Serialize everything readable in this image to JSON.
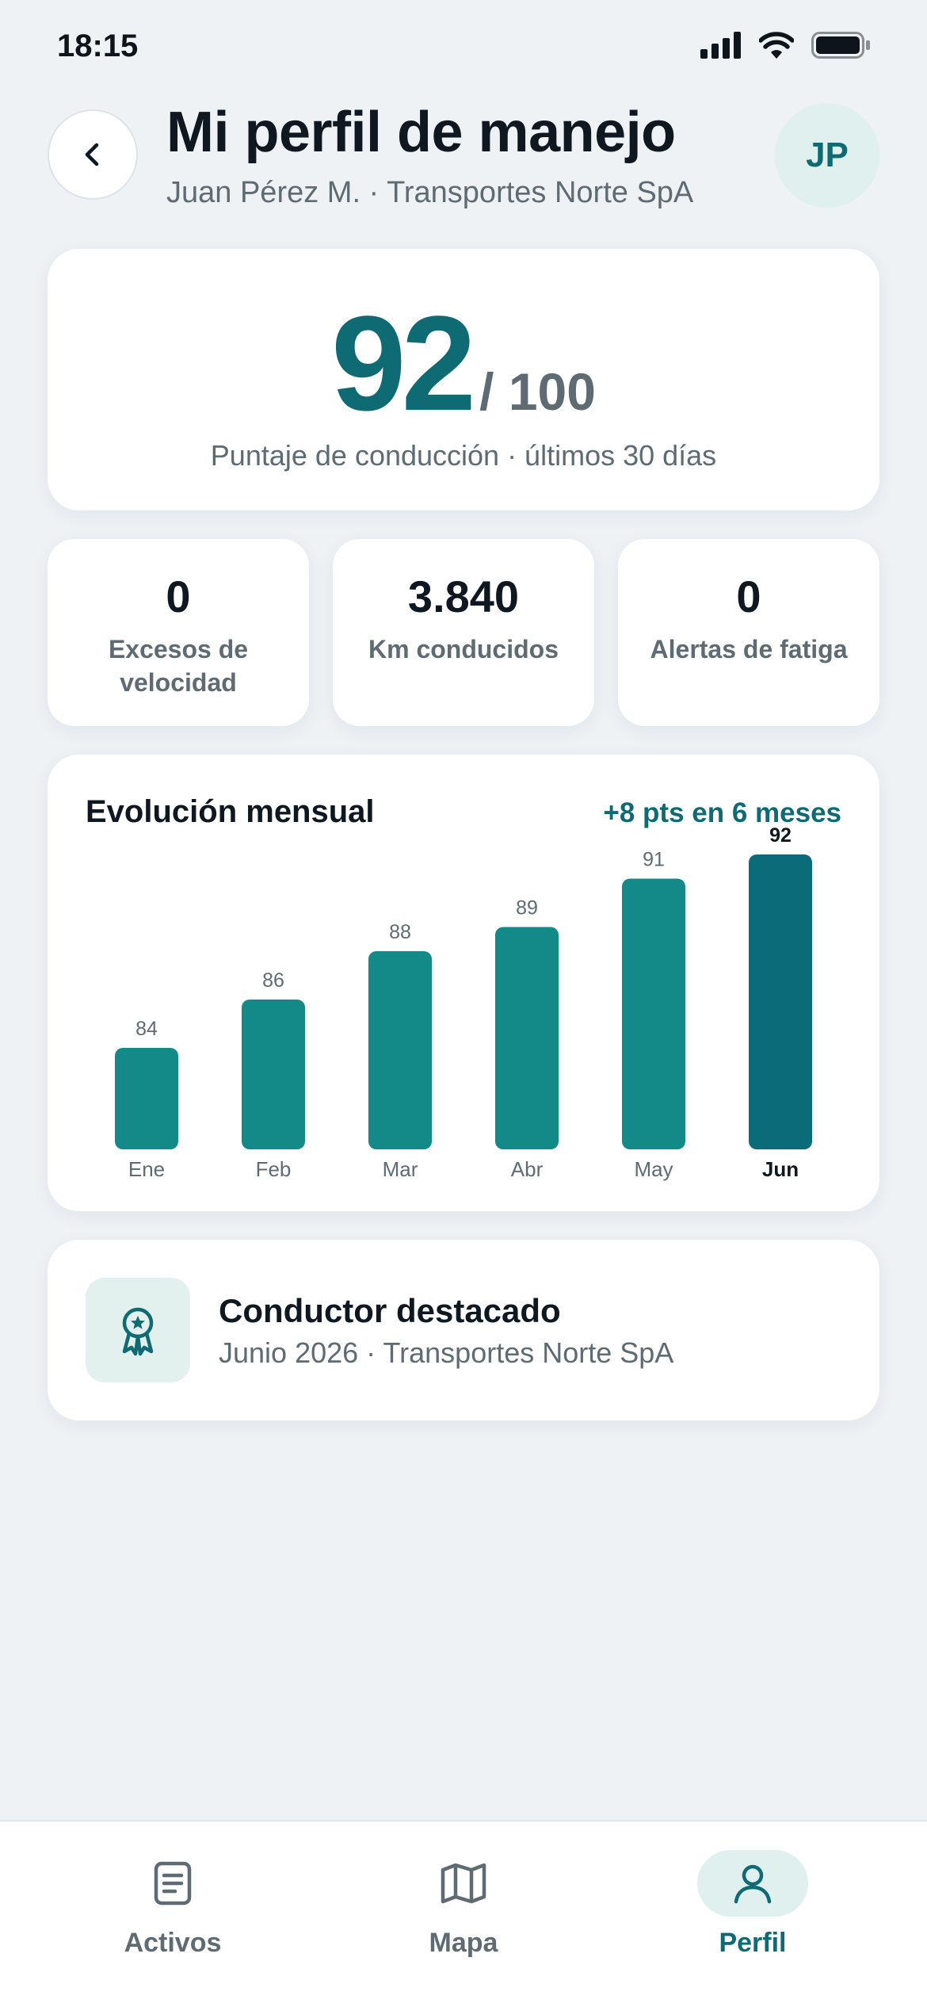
{
  "status_bar": {
    "time": "18:15"
  },
  "header": {
    "title": "Mi perfil de manejo",
    "subtitle": "Juan Pérez M. · Transportes Norte SpA",
    "avatar_initials": "JP"
  },
  "score": {
    "value": "92",
    "max": "/ 100",
    "label": "Puntaje de conducción · últimos 30 días"
  },
  "stats": [
    {
      "value": "0",
      "label": "Excesos de velocidad"
    },
    {
      "value": "3.840",
      "label": "Km conducidos"
    },
    {
      "value": "0",
      "label": "Alertas de fatiga"
    }
  ],
  "chart_data": {
    "type": "bar",
    "title": "Evolución mensual",
    "annotation": "+8 pts en 6 meses",
    "categories": [
      "Ene",
      "Feb",
      "Mar",
      "Abr",
      "May",
      "Jun"
    ],
    "values": [
      84,
      86,
      88,
      89,
      91,
      92
    ],
    "highlight_index": 5,
    "colors": {
      "bar": "#138a88",
      "highlight": "#0b6b78"
    }
  },
  "badge": {
    "title": "Conductor destacado",
    "subtitle": "Junio 2026 · Transportes Norte SpA",
    "icon": "award-icon"
  },
  "nav": {
    "items": [
      {
        "label": "Activos",
        "icon": "document-icon",
        "active": false
      },
      {
        "label": "Mapa",
        "icon": "map-icon",
        "active": false
      },
      {
        "label": "Perfil",
        "icon": "user-icon",
        "active": true
      }
    ]
  },
  "colors": {
    "accent": "#0e6b74",
    "background": "#eef2f5",
    "muted": "#5f6b73"
  }
}
